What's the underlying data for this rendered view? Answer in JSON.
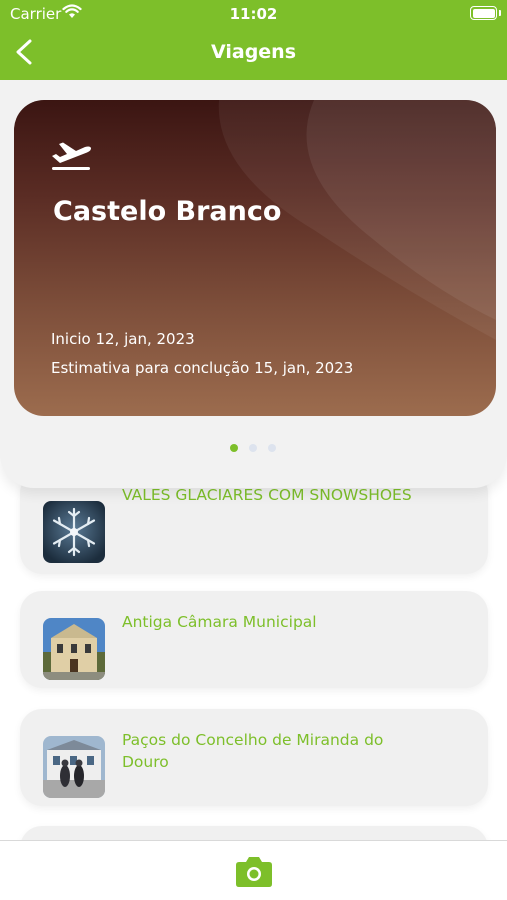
{
  "status_bar": {
    "carrier": "Carrier",
    "time": "11:02"
  },
  "header": {
    "title": "Viagens",
    "back_icon": "chevron-left-icon"
  },
  "trip": {
    "city": "Castelo Branco",
    "start": "Inicio 12, jan, 2023",
    "estimate": "Estimativa para conclução 15, jan, 2023",
    "icon": "airplane-takeoff-icon",
    "carousel_pages": 3,
    "carousel_active_page": 1
  },
  "items": [
    {
      "title": "VALES GLACIARES COM SNOWSHOES",
      "thumbnail": "snowflake-photo"
    },
    {
      "title": "Antiga Câmara Municipal",
      "thumbnail": "building-photo"
    },
    {
      "title": "Paços do Concelho de Miranda do Douro",
      "thumbnail": "town-hall-photo"
    }
  ],
  "tab_bar": {
    "icon": "camera-icon"
  },
  "colors": {
    "primary": "#7dbf2a",
    "card_background": "#f0f0f0",
    "dot_active": "#7dbf2a",
    "dot_inactive": "#dde3ee"
  }
}
